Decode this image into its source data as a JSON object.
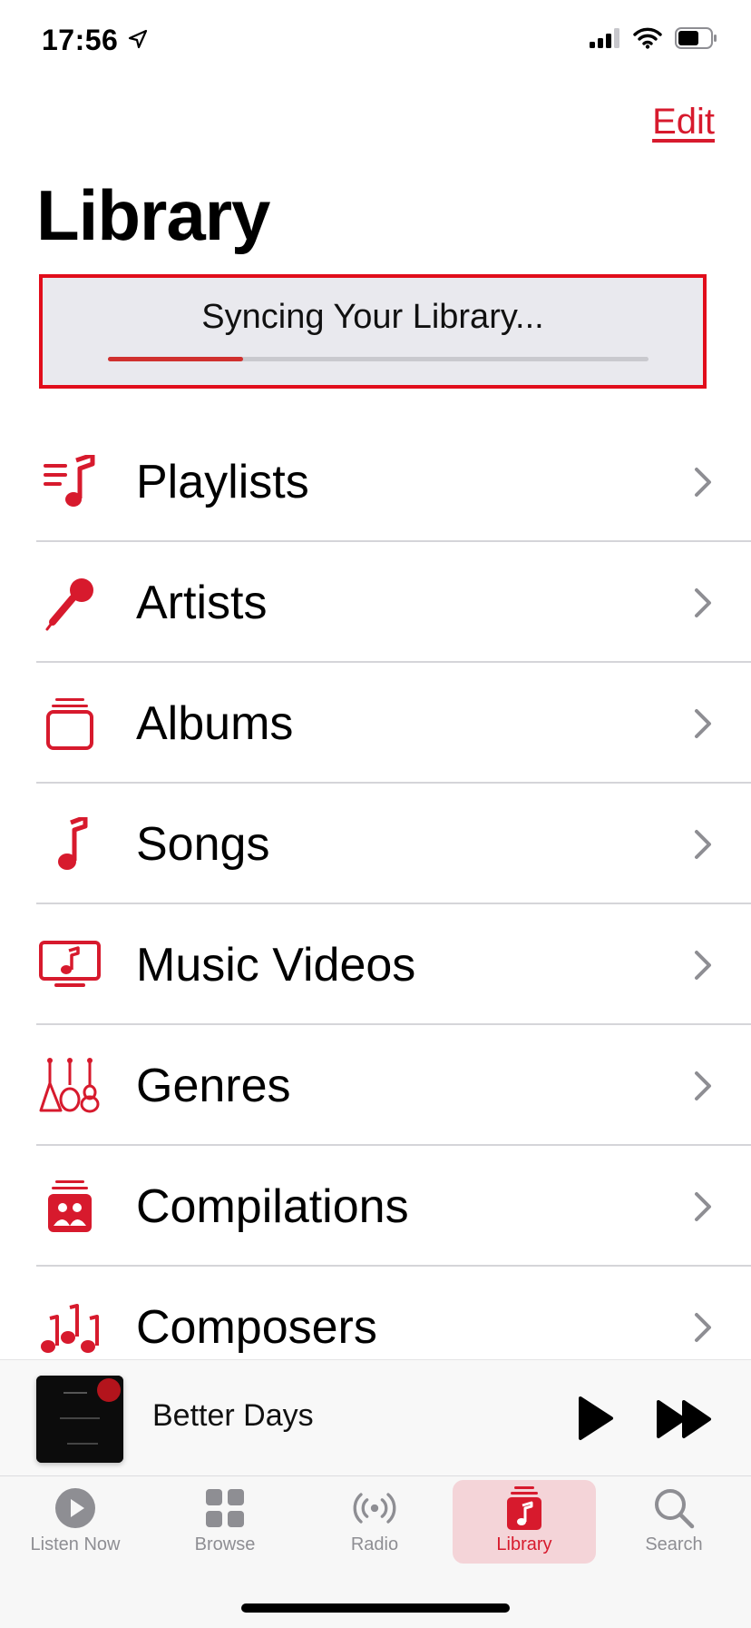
{
  "status_bar": {
    "time": "17:56",
    "icons": [
      "location-arrow-icon",
      "cellular-signal-icon",
      "wifi-icon",
      "battery-icon"
    ]
  },
  "header": {
    "edit_label": "Edit",
    "title": "Library"
  },
  "sync": {
    "text": "Syncing Your Library...",
    "progress": 0.25
  },
  "library_items": [
    {
      "label": "Playlists",
      "icon": "playlists-icon"
    },
    {
      "label": "Artists",
      "icon": "microphone-icon"
    },
    {
      "label": "Albums",
      "icon": "album-stack-icon"
    },
    {
      "label": "Songs",
      "icon": "music-note-icon"
    },
    {
      "label": "Music Videos",
      "icon": "tv-music-icon"
    },
    {
      "label": "Genres",
      "icon": "guitars-icon"
    },
    {
      "label": "Compilations",
      "icon": "compilation-people-icon"
    },
    {
      "label": "Composers",
      "icon": "music-notes-icon"
    }
  ],
  "now_playing": {
    "title": "Better Days",
    "icons": [
      "play-icon",
      "forward-icon"
    ]
  },
  "tabs": [
    {
      "label": "Listen Now",
      "icon": "play-circle-icon",
      "active": false
    },
    {
      "label": "Browse",
      "icon": "grid-icon",
      "active": false
    },
    {
      "label": "Radio",
      "icon": "radio-waves-icon",
      "active": false
    },
    {
      "label": "Library",
      "icon": "library-note-icon",
      "active": true
    },
    {
      "label": "Search",
      "icon": "magnifier-icon",
      "active": false
    }
  ],
  "colors": {
    "accent": "#d71a2d",
    "highlight_border": "#e10d1b",
    "banner_bg": "#e9e9ee",
    "tab_inactive": "#8e8e93"
  }
}
